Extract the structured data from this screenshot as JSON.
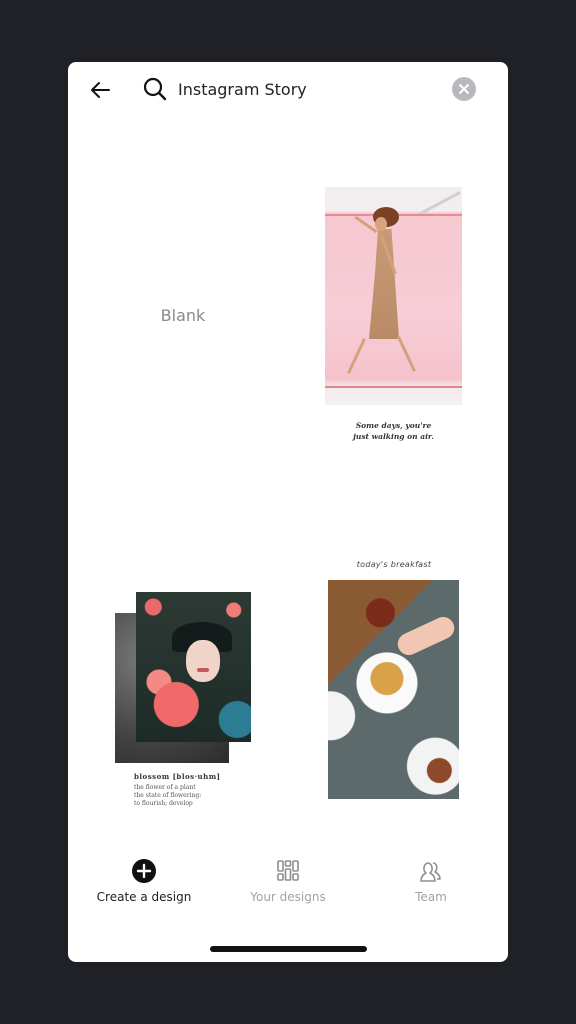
{
  "header": {
    "search_value": "Instagram Story",
    "back_icon": "arrow-left-icon",
    "search_icon": "search-icon",
    "clear_icon": "close-circle-icon"
  },
  "templates": [
    {
      "kind": "blank",
      "label": "Blank"
    },
    {
      "kind": "photo",
      "name": "walking-on-air",
      "caption_lines": [
        "Some days, you're",
        "just walking on air."
      ],
      "accent_color": "#f6c7d0"
    },
    {
      "kind": "photo",
      "name": "blossom",
      "title": "blossom [blos·uhm]",
      "desc_lines": [
        "the flower of a plant",
        "the state of flowering:",
        "to flourish; develop"
      ]
    },
    {
      "kind": "photo",
      "name": "breakfast",
      "heading": "today's breakfast"
    }
  ],
  "bottom_nav": {
    "items": [
      {
        "label": "Create a design",
        "icon": "plus-circle-icon",
        "active": true
      },
      {
        "label": "Your designs",
        "icon": "designs-grid-icon",
        "active": false
      },
      {
        "label": "Team",
        "icon": "team-icon",
        "active": false
      }
    ]
  },
  "colors": {
    "background": "#1f2126",
    "card": "#ffffff",
    "active_text": "#222222",
    "inactive_text": "#a3a3a8"
  }
}
